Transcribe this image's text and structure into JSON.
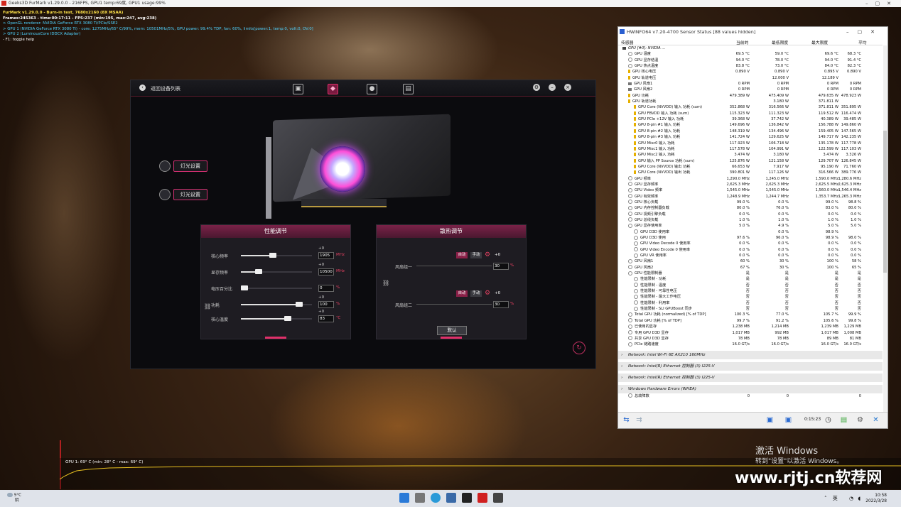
{
  "window_title": "Geeks3D FurMark v1.29.0.0 - 216FPS, GPU1 temp:69度, GPU1 usage:99%",
  "furmark": {
    "line1": "FurMark v1.29.0.0 - Burn-in test, 7680x2160 (8X MSAA)",
    "line2": "Frames:245363 - time:00:17:11 - FPS:237 (min:195, max:247, avg:238)",
    "line3": "> OpenGL renderer: NVIDIA GeForce RTX 3080 Ti/PCIe/SSE2",
    "line4": "> GPU 1 (NVIDIA GeForce RTX 3080 Ti) - core: 1275MHz/65° C/99%, mem: 10501MHz/5%, GPU power: 99.4% TDP, fan: 60%, limits[power:1, temp:0, volt:0, OV:0]",
    "line5": "> GPU 2 (LuminousCore IDDCX Adapter)",
    "line6": "- F1: toggle help",
    "graph_label": "GPU 1: 69° C (min: 28° C - max: 69° C)"
  },
  "argus": {
    "back_label": "返回设备列表",
    "light_btn_1": "灯光设置",
    "light_btn_2": "灯光设置",
    "perf_title": "性能调节",
    "cool_title": "散热调节",
    "sliders": [
      {
        "label": "核心频率",
        "delta": "+0",
        "value": "1905",
        "unit": "MHz",
        "pos": 0.45
      },
      {
        "label": "显存频率",
        "delta": "+0",
        "value": "10500",
        "unit": "MHz",
        "pos": 0.25
      },
      {
        "label": "电压百分比",
        "delta": "",
        "value": "0",
        "unit": "%",
        "pos": 0.05
      },
      {
        "label": "功耗",
        "delta": "+0",
        "value": "100",
        "unit": "%",
        "pos": 0.82
      },
      {
        "label": "核心温度",
        "delta": "+0",
        "value": "83",
        "unit": "℃",
        "pos": 0.66
      }
    ],
    "fans": [
      {
        "label": "风扇组一",
        "auto": "自动",
        "manual": "手动",
        "delta": "+0",
        "value": "30",
        "unit": "%"
      },
      {
        "label": "风扇组二",
        "auto": "自动",
        "manual": "手动",
        "delta": "+0",
        "value": "30",
        "unit": "%"
      }
    ],
    "default_btn": "默认"
  },
  "hwinfo": {
    "title": "HWiNFO64 v7.20-4700 Sensor Status [88 values hidden]",
    "columns": [
      "传感器",
      "当前的",
      "最低限度",
      "最大限度",
      "平均"
    ],
    "rows": [
      {
        "k": "group",
        "n": "GPU [#0]: NVIDIA ...",
        "c": "",
        "mn": "",
        "mx": "",
        "a": ""
      },
      {
        "k": "t",
        "n": "GPU 温度",
        "c": "69.5 °C",
        "mn": "59.0 °C",
        "mx": "69.6 °C",
        "a": "68.3 °C"
      },
      {
        "k": "t",
        "n": "GPU 显存结温",
        "c": "94.0 °C",
        "mn": "78.0 °C",
        "mx": "94.0 °C",
        "a": "91.4 °C"
      },
      {
        "k": "t",
        "n": "GPU 热点温度",
        "c": "83.8 °C",
        "mn": "73.0 °C",
        "mx": "84.0 °C",
        "a": "82.3 °C"
      },
      {
        "k": "b",
        "n": "GPU 核心电压",
        "c": "0.890 V",
        "mn": "0.890 V",
        "mx": "0.895 V",
        "a": "0.890 V"
      },
      {
        "k": "b",
        "n": "GPU 轨道电压",
        "c": "",
        "mn": "12.000 V",
        "mx": "12.189 V",
        "a": ""
      },
      {
        "k": "s",
        "n": "GPU 风扇1",
        "c": "0 RPM",
        "mn": "0 RPM",
        "mx": "0 RPM",
        "a": "0 RPM"
      },
      {
        "k": "s",
        "n": "GPU 风扇2",
        "c": "0 RPM",
        "mn": "0 RPM",
        "mx": "0 RPM",
        "a": "0 RPM"
      },
      {
        "k": "b",
        "n": "GPU 功耗",
        "c": "479.389 W",
        "mn": "475.409 W",
        "mx": "479.635 W",
        "a": "478.923 W"
      },
      {
        "k": "b",
        "n": "GPU 轨道功耗",
        "c": "",
        "mn": "3.180 W",
        "mx": "371.811 W",
        "a": ""
      },
      {
        "k": "b2",
        "n": "GPU Core (NVVDD) 输入 功耗 (sum)",
        "c": "352.868 W",
        "mn": "316.566 W",
        "mx": "371.811 W",
        "a": "351.895 W"
      },
      {
        "k": "b2",
        "n": "GPU FBVDD 输入 功耗 (sum)",
        "c": "115.323 W",
        "mn": "111.323 W",
        "mx": "119.512 W",
        "a": "116.474 W"
      },
      {
        "k": "b2",
        "n": "GPU PCIe +12V 输入 功耗",
        "c": "39.368 W",
        "mn": "37.742 W",
        "mx": "40.389 W",
        "a": "39.485 W"
      },
      {
        "k": "b2",
        "n": "GPU 8-pin #1 输入 功耗",
        "c": "149.696 W",
        "mn": "136.842 W",
        "mx": "156.788 W",
        "a": "149.860 W"
      },
      {
        "k": "b2",
        "n": "GPU 8-pin #2 输入 功耗",
        "c": "148.319 W",
        "mn": "134.496 W",
        "mx": "159.405 W",
        "a": "147.565 W"
      },
      {
        "k": "b2",
        "n": "GPU 8-pin #3 输入 功耗",
        "c": "141.724 W",
        "mn": "129.625 W",
        "mx": "149.717 W",
        "a": "142.235 W"
      },
      {
        "k": "b2",
        "n": "GPU Misc0 输入 功耗",
        "c": "117.923 W",
        "mn": "106.718 W",
        "mx": "135.178 W",
        "a": "117.778 W"
      },
      {
        "k": "b2",
        "n": "GPU Misc1 输入 功耗",
        "c": "117.578 W",
        "mn": "104.991 W",
        "mx": "122.599 W",
        "a": "117.103 W"
      },
      {
        "k": "b2",
        "n": "GPU Misc2 输入 功耗",
        "c": "3.474 W",
        "mn": "3.180 W",
        "mx": "3.474 W",
        "a": "3.326 W"
      },
      {
        "k": "b2",
        "n": "GPU 输入 PP Source 功耗 (sum)",
        "c": "125.876 W",
        "mn": "121.158 W",
        "mx": "129.707 W",
        "a": "126.845 W"
      },
      {
        "k": "b2",
        "n": "GPU Core (NVVDD) 输出 功耗",
        "c": "66.653 W",
        "mn": "7.917 W",
        "mx": "95.190 W",
        "a": "71.760 W"
      },
      {
        "k": "b2",
        "n": "GPU Core (NVVDD) 输出 功耗",
        "c": "390.801 W",
        "mn": "117.126 W",
        "mx": "316.566 W",
        "a": "389.776 W"
      },
      {
        "k": "d",
        "n": "GPU 频率",
        "c": "1,290.0 MHz",
        "mn": "1,245.0 MHz",
        "mx": "1,590.0 MHz",
        "a": "1,280.6 MHz"
      },
      {
        "k": "d",
        "n": "GPU 显存频率",
        "c": "2,625.3 MHz",
        "mn": "2,625.3 MHz",
        "mx": "2,625.5 MHz",
        "a": "2,625.3 MHz"
      },
      {
        "k": "d",
        "n": "GPU Video 频率",
        "c": "1,545.0 MHz",
        "mn": "1,545.0 MHz",
        "mx": "1,560.0 MHz",
        "a": "1,546.4 MHz"
      },
      {
        "k": "d",
        "n": "GPU 有效频率",
        "c": "1,248.9 MHz",
        "mn": "1,244.7 MHz",
        "mx": "1,353.7 MHz",
        "a": "1,265.3 MHz"
      },
      {
        "k": "d",
        "n": "GPU 核心负载",
        "c": "99.0 %",
        "mn": "0.0 %",
        "mx": "99.0 %",
        "a": "98.8 %"
      },
      {
        "k": "d",
        "n": "GPU 内存控制器负载",
        "c": "80.0 %",
        "mn": "76.0 %",
        "mx": "83.0 %",
        "a": "80.0 %"
      },
      {
        "k": "d",
        "n": "GPU 视频引擎负载",
        "c": "0.0 %",
        "mn": "0.0 %",
        "mx": "0.0 %",
        "a": "0.0 %"
      },
      {
        "k": "d",
        "n": "GPU 总线负载",
        "c": "1.0 %",
        "mn": "1.0 %",
        "mx": "1.0 %",
        "a": "1.0 %"
      },
      {
        "k": "d",
        "n": "GPU 显存使用率",
        "c": "5.0 %",
        "mn": "4.9 %",
        "mx": "5.0 %",
        "a": "5.0 %"
      },
      {
        "k": "d2",
        "n": "GPU D3D 使用率",
        "c": "",
        "mn": "0.0 %",
        "mx": "98.9 %",
        "a": ""
      },
      {
        "k": "d2",
        "n": "GPU D3D 使用",
        "c": "97.6 %",
        "mn": "96.0 %",
        "mx": "98.9 %",
        "a": "98.0 %"
      },
      {
        "k": "d2",
        "n": "GPU Video Decode 0 使用率",
        "c": "0.0 %",
        "mn": "0.0 %",
        "mx": "0.0 %",
        "a": "0.0 %"
      },
      {
        "k": "d2",
        "n": "GPU Video Encode 0 使用率",
        "c": "0.0 %",
        "mn": "0.0 %",
        "mx": "0.0 %",
        "a": "0.0 %"
      },
      {
        "k": "d2",
        "n": "GPU VR 使用率",
        "c": "0.0 %",
        "mn": "0.0 %",
        "mx": "0.0 %",
        "a": "0.0 %"
      },
      {
        "k": "d",
        "n": "GPU 风扇1",
        "c": "60 %",
        "mn": "30 %",
        "mx": "100 %",
        "a": "58 %"
      },
      {
        "k": "d",
        "n": "GPU 风扇2",
        "c": "67 %",
        "mn": "30 %",
        "mx": "100 %",
        "a": "65 %"
      },
      {
        "k": "d",
        "n": "GPU 性能限制器",
        "c": "是",
        "mn": "是",
        "mx": "是",
        "a": "是"
      },
      {
        "k": "d2",
        "n": "性能限制 - 功耗",
        "c": "是",
        "mn": "是",
        "mx": "是",
        "a": "是"
      },
      {
        "k": "d2",
        "n": "性能限制 - 温度",
        "c": "否",
        "mn": "否",
        "mx": "否",
        "a": "否"
      },
      {
        "k": "d2",
        "n": "性能限制 - 可靠性电压",
        "c": "否",
        "mn": "否",
        "mx": "否",
        "a": "否"
      },
      {
        "k": "d2",
        "n": "性能限制 - 最大工作电压",
        "c": "否",
        "mn": "否",
        "mx": "否",
        "a": "否"
      },
      {
        "k": "d2",
        "n": "性能限制 - 利用率",
        "c": "否",
        "mn": "否",
        "mx": "否",
        "a": "否"
      },
      {
        "k": "d2",
        "n": "性能限制 - SLI GPUBoost 同步",
        "c": "否",
        "mn": "否",
        "mx": "否",
        "a": "否"
      },
      {
        "k": "d",
        "n": "Total GPU 功耗 (normalized) [% of TDP]",
        "c": "100.3 %",
        "mn": "77.0 %",
        "mx": "105.7 %",
        "a": "99.9 %"
      },
      {
        "k": "d",
        "n": "Total GPU 功耗 [% of TDP]",
        "c": "99.7 %",
        "mn": "91.2 %",
        "mx": "105.6 %",
        "a": "99.8 %"
      },
      {
        "k": "d",
        "n": "已使用的显存",
        "c": "1,238 MB",
        "mn": "1,214 MB",
        "mx": "1,239 MB",
        "a": "1,229 MB"
      },
      {
        "k": "d",
        "n": "专用 GPU D3D 显存",
        "c": "1,017 MB",
        "mn": "992 MB",
        "mx": "1,017 MB",
        "a": "1,008 MB"
      },
      {
        "k": "d",
        "n": "共享 GPU D3D 显存",
        "c": "78 MB",
        "mn": "78 MB",
        "mx": "89 MB",
        "a": "81 MB"
      },
      {
        "k": "d",
        "n": "PCIe 链路速度",
        "c": "16.0 GT/s",
        "mn": "16.0 GT/s",
        "mx": "16.0 GT/s",
        "a": "16.0 GT/s"
      }
    ],
    "sections": [
      "Network: Intel Wi-Fi 6E AX210 160MHz",
      "Network: Intel(R) Ethernet 控制器 (3) I225-V",
      "Network: Intel(R) Ethernet 控制器 (3) I225-V",
      "Windows Hardware Errors (WHEA)"
    ],
    "whea_row": {
      "n": "总故障数",
      "c": "0",
      "mn": "0",
      "a": "0"
    },
    "timer": "0:15:23"
  },
  "desktop": {
    "activate_1": "激活 Windows",
    "activate_2": "转到\"设置\"以激活 Windows。",
    "watermark": "www.rjtj.cn软荐网"
  },
  "taskbar": {
    "weather_temp": "9°C",
    "weather_desc": "阴",
    "ime": "英",
    "time": "10:58",
    "date": "2022/3/28"
  }
}
